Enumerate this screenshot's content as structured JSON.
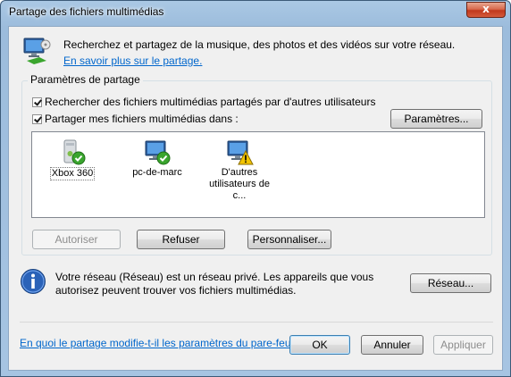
{
  "window": {
    "title": "Partage des fichiers multimédias",
    "close_glyph": "x"
  },
  "header": {
    "icon": "network-media-sharing-icon",
    "description": "Recherchez et partagez de la musique, des photos et des vidéos sur votre réseau.",
    "link": "En savoir plus sur le partage."
  },
  "sharing_settings": {
    "group_label": "Paramètres de partage",
    "find_media_checkbox": {
      "label": "Rechercher des fichiers multimédias partagés par d'autres utilisateurs",
      "checked": true
    },
    "share_media_checkbox": {
      "label": "Partager mes fichiers multimédias dans :",
      "checked": true
    },
    "settings_button": "Paramètres...",
    "devices": [
      {
        "name": "Xbox 360",
        "icon": "xbox-allowed-icon",
        "status": "allowed"
      },
      {
        "name": "pc-de-marc",
        "icon": "computer-allowed-icon",
        "status": "allowed"
      },
      {
        "name": "D'autres utilisateurs de c...",
        "icon": "computer-warning-icon",
        "status": "warning"
      }
    ],
    "buttons": {
      "allow": "Autoriser",
      "deny": "Refuser",
      "customize": "Personnaliser..."
    }
  },
  "network_info": {
    "icon": "info-icon",
    "text": "Votre réseau (Réseau) est un réseau privé. Les appareils que vous autorisez peuvent trouver vos fichiers multimédias.",
    "network_button": "Réseau..."
  },
  "footer": {
    "firewall_link": "En quoi le partage modifie-t-il les paramètres du pare-feu ?",
    "ok": "OK",
    "cancel": "Annuler",
    "apply": "Appliquer"
  },
  "colors": {
    "link": "#0066cc",
    "allowed_badge": "#3aa52e",
    "warning_badge": "#f2c400",
    "info_blue": "#2a62b8"
  }
}
